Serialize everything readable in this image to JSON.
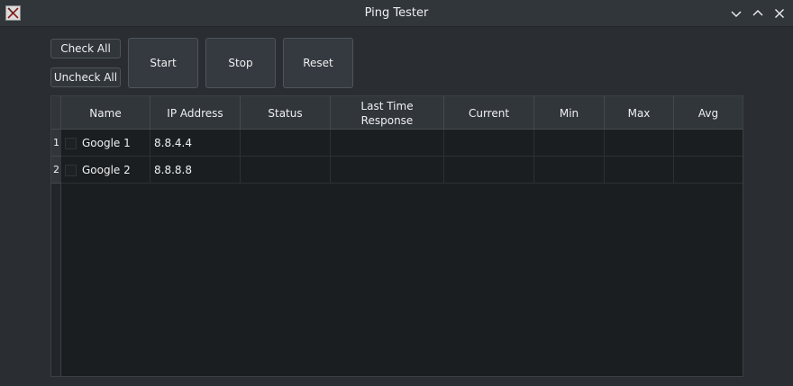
{
  "window": {
    "title": "Ping Tester",
    "icons": {
      "app": "app-icon",
      "minimize": "chevron-down-icon",
      "maximize": "chevron-up-icon",
      "close": "close-icon"
    }
  },
  "toolbar": {
    "check_all": "Check All",
    "uncheck_all": "Uncheck All",
    "start": "Start",
    "stop": "Stop",
    "reset": "Reset"
  },
  "table": {
    "columns": [
      "Name",
      "IP Address",
      "Status",
      "Last Time\nResponse",
      "Current",
      "Min",
      "Max",
      "Avg"
    ],
    "rows": [
      {
        "num": "1",
        "checked": false,
        "name": "Google 1",
        "ip": "8.8.4.4",
        "status": "",
        "last": "",
        "current": "",
        "min": "",
        "max": "",
        "avg": ""
      },
      {
        "num": "2",
        "checked": false,
        "name": "Google 2",
        "ip": "8.8.8.8",
        "status": "",
        "last": "",
        "current": "",
        "min": "",
        "max": "",
        "avg": ""
      }
    ]
  },
  "colors": {
    "window_bg": "#2a2e32",
    "table_bg": "#1b1e20",
    "header_bg": "#31363b",
    "text": "#eff0f1"
  }
}
